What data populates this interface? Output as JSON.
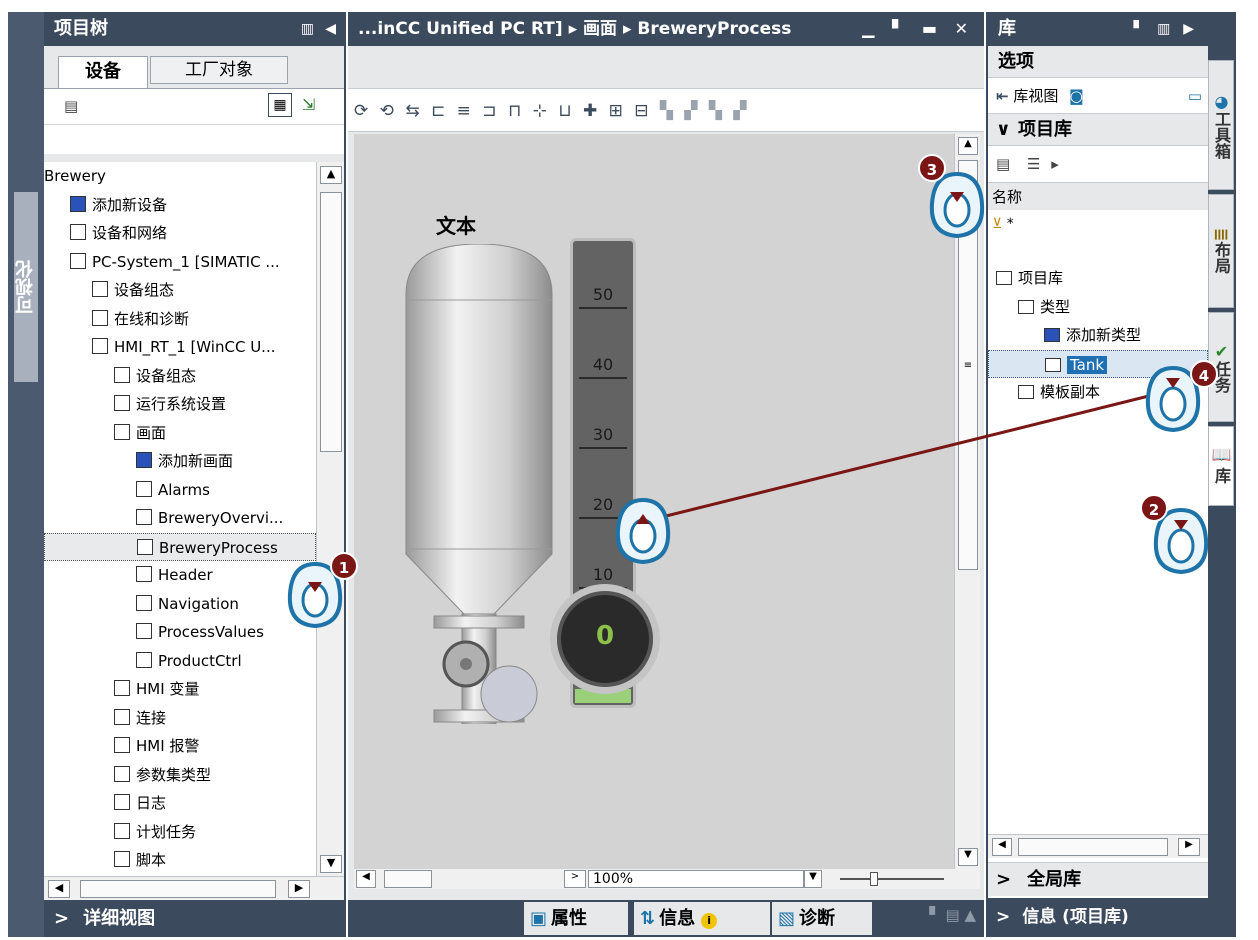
{
  "left_strip": {
    "label": "可视化"
  },
  "project_tree": {
    "title": "项目树",
    "tabs": [
      "设备",
      "工厂对象"
    ],
    "items": [
      {
        "label": "Brewery",
        "indent": 0
      },
      {
        "label": "添加新设备",
        "indent": 1
      },
      {
        "label": "设备和网络",
        "indent": 1
      },
      {
        "label": "PC-System_1 [SIMATIC ...",
        "indent": 1
      },
      {
        "label": "设备组态",
        "indent": 2
      },
      {
        "label": "在线和诊断",
        "indent": 2
      },
      {
        "label": "HMI_RT_1 [WinCC U...",
        "indent": 2
      },
      {
        "label": "设备组态",
        "indent": 3
      },
      {
        "label": "运行系统设置",
        "indent": 3
      },
      {
        "label": "画面",
        "indent": 3
      },
      {
        "label": "添加新画面",
        "indent": 4
      },
      {
        "label": "Alarms",
        "indent": 4
      },
      {
        "label": "BreweryOvervi...",
        "indent": 4
      },
      {
        "label": "BreweryProcess",
        "indent": 4
      },
      {
        "label": "Header",
        "indent": 4
      },
      {
        "label": "Navigation",
        "indent": 4
      },
      {
        "label": "ProcessValues",
        "indent": 4
      },
      {
        "label": "ProductCtrl",
        "indent": 4
      },
      {
        "label": "HMI 变量",
        "indent": 3
      },
      {
        "label": "连接",
        "indent": 3
      },
      {
        "label": "HMI 报警",
        "indent": 3
      },
      {
        "label": "参数集类型",
        "indent": 3
      },
      {
        "label": "日志",
        "indent": 3
      },
      {
        "label": "计划任务",
        "indent": 3
      },
      {
        "label": "脚本",
        "indent": 3
      }
    ],
    "detail_view": "详细视图"
  },
  "editor": {
    "breadcrumb": "...inCC Unified PC RT] ▸ 画面 ▸ BreweryProcess",
    "canvas_text": "文本",
    "gauge_ticks": [
      "50",
      "40",
      "30",
      "20",
      "10"
    ],
    "gauge_value": "0",
    "zoom": "100%",
    "bottom_tabs": {
      "properties": "属性",
      "info": "信息",
      "diagnostics": "诊断"
    }
  },
  "library": {
    "title": "库",
    "options": "选项",
    "library_view": "库视图",
    "project_library": "项目库",
    "name_col": "名称",
    "filter": "*",
    "tree": [
      {
        "label": "项目库",
        "indent": 0
      },
      {
        "label": "类型",
        "indent": 1
      },
      {
        "label": "添加新类型",
        "indent": 2
      },
      {
        "label": "Tank",
        "indent": 2
      },
      {
        "label": "模板副本",
        "indent": 1
      }
    ],
    "global_library": "全局库",
    "info_project_library": "信息 (项目库)"
  },
  "right_tabs": [
    "工具箱",
    "布局",
    "任务",
    "库"
  ],
  "callouts": [
    "1",
    "2",
    "3",
    "4"
  ],
  "colors": {
    "header": "#3c4a5d",
    "accent": "#1e73a8",
    "badge": "#7a1616",
    "selection": "#1f6fb5"
  }
}
